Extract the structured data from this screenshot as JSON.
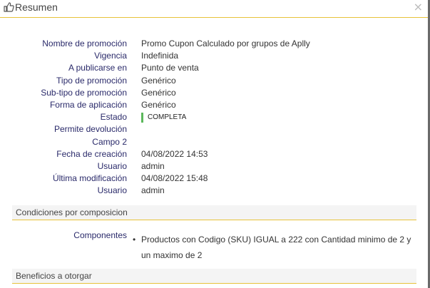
{
  "dialog": {
    "title": "Resumen",
    "close_symbol": "×",
    "title_icon": "thumbs-up-icon"
  },
  "details": [
    {
      "label": "Nombre de promoción",
      "value": "Promo Cupon Calculado por grupos de Aplly"
    },
    {
      "label": "Vigencia",
      "value": "Indefinida"
    },
    {
      "label": "A publicarse en",
      "value": "Punto de venta"
    },
    {
      "label": "Tipo de promoción",
      "value": "Genérico"
    },
    {
      "label": "Sub-tipo de promoción",
      "value": "Genérico"
    },
    {
      "label": "Forma de aplicación",
      "value": "Genérico"
    },
    {
      "label": "Estado",
      "value": "COMPLETA",
      "color": "#5cb85c"
    },
    {
      "label": "Permite devolución",
      "value": ""
    },
    {
      "label": "Campo 2",
      "value": ""
    },
    {
      "label": "Fecha de creación",
      "value": "04/08/2022 14:53"
    },
    {
      "label": "Usuario",
      "value": "admin"
    },
    {
      "label": "Última modificación",
      "value": "04/08/2022 15:48"
    },
    {
      "label": "Usuario",
      "value": "admin"
    }
  ],
  "sections": {
    "conditions_title": "Condiciones por composicion",
    "components_label": "Componentes",
    "components": [
      "Productos con Codigo (SKU) IGUAL a 222 con Cantidad minimo de 2 y un maximo de 2"
    ],
    "benefits_title": "Beneficios a otorgar"
  },
  "colors": {
    "accent_line": "#e7c33a",
    "label_text": "#2a2a6a",
    "status_ok": "#5cb85c"
  }
}
